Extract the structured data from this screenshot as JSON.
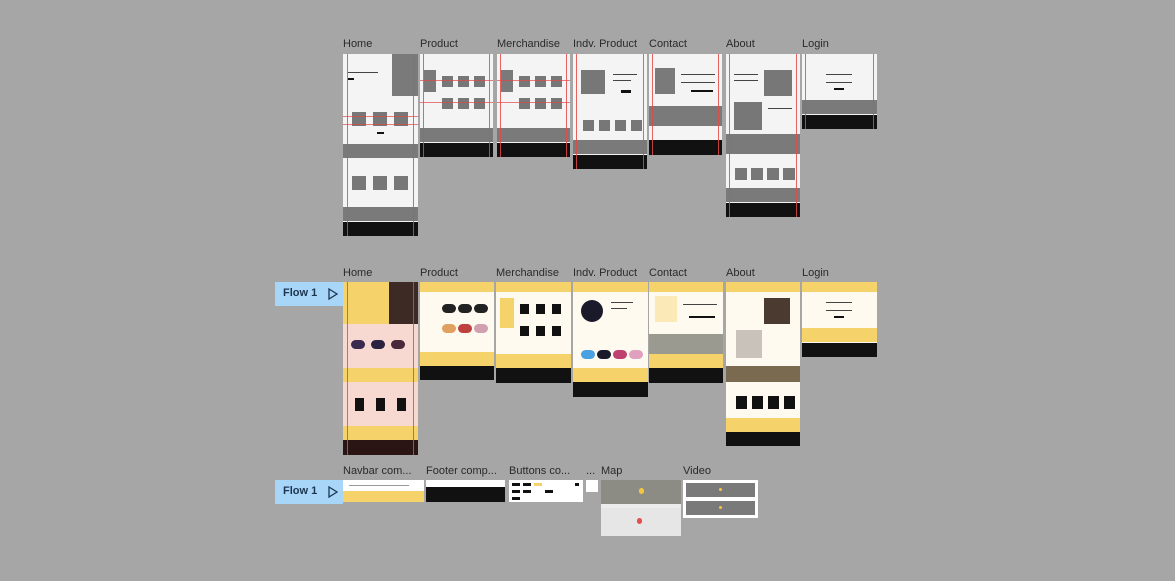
{
  "rows": {
    "wireframe_labels": [
      "Home",
      "Product",
      "Merchandise",
      "Indv. Product",
      "Contact",
      "About",
      "Login"
    ],
    "hifi_labels": [
      "Home",
      "Product",
      "Merchandise",
      "Indv. Product",
      "Contact",
      "About",
      "Login"
    ],
    "component_labels": [
      "Navbar com...",
      "Footer comp...",
      "Buttons co...",
      "...",
      "Map",
      "Video"
    ]
  },
  "flows": [
    {
      "label": "Flow 1",
      "icon": "play-icon"
    },
    {
      "label": "Flow 1",
      "icon": "play-icon"
    }
  ],
  "colors": {
    "canvas": "#a6a6a6",
    "flow_badge": "#a8d6f8",
    "layout_grid": "#e64646",
    "accent_yellow": "#f5d36a",
    "footer_dark": "#111111"
  }
}
